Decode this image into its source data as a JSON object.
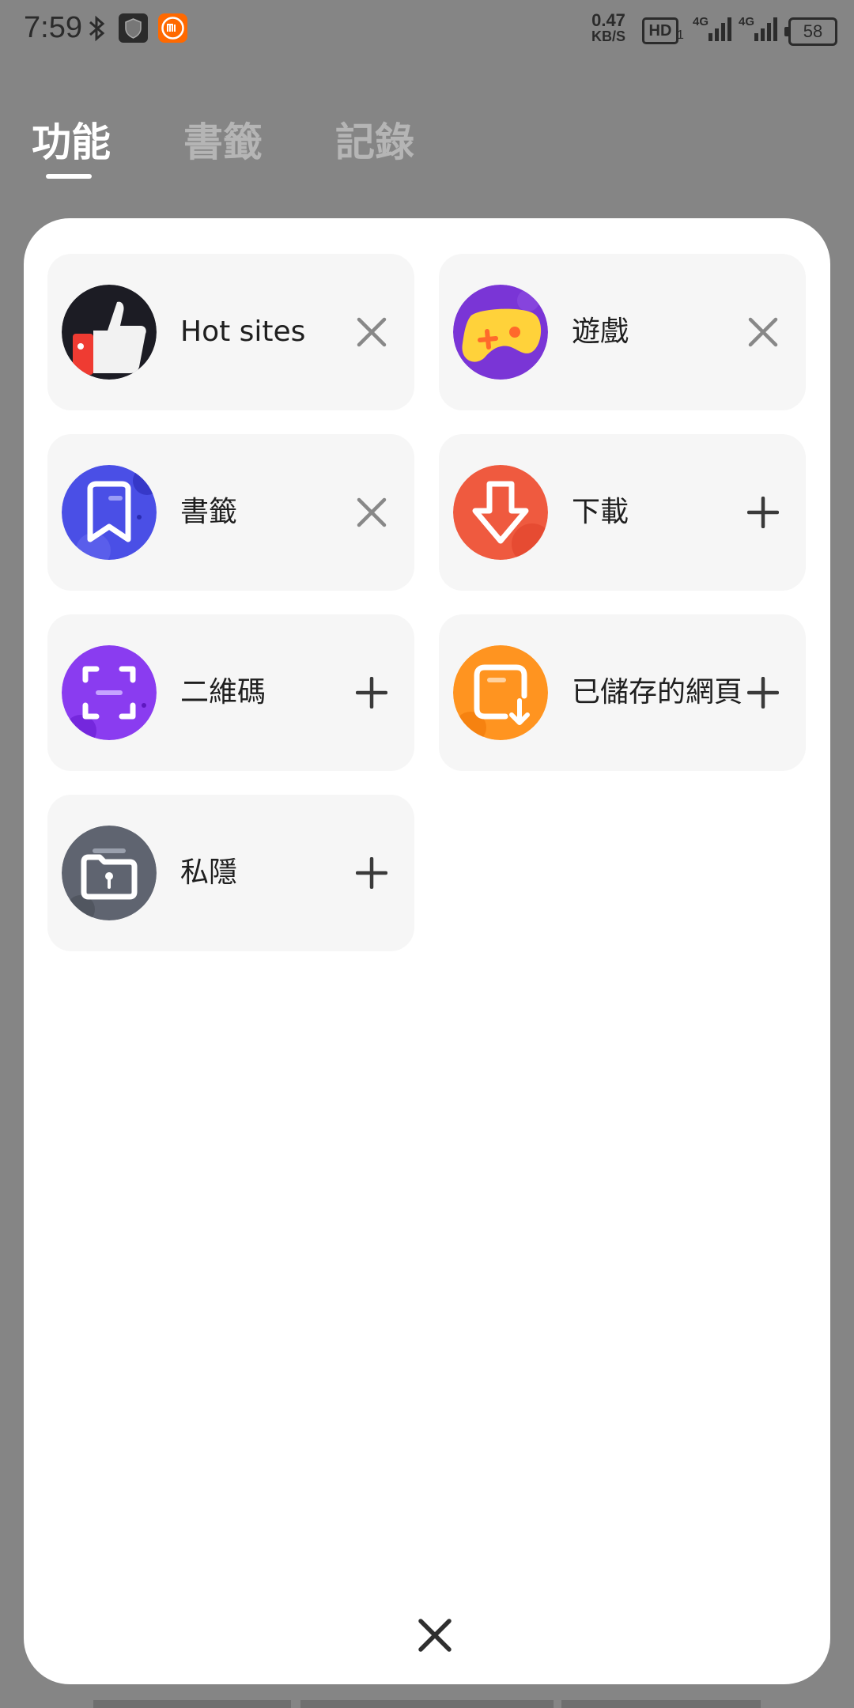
{
  "status_bar": {
    "time": "7:59",
    "net_speed_value": "0.47",
    "net_speed_unit": "KB/S",
    "hd_label": "HD",
    "hd_sub": "1",
    "signal1_label": "4G",
    "signal2_label": "4G",
    "battery": "58"
  },
  "tabs": [
    {
      "label": "功能",
      "active": true
    },
    {
      "label": "書籤",
      "active": false
    },
    {
      "label": "記錄",
      "active": false
    }
  ],
  "cards": [
    {
      "label": "Hot sites",
      "icon": "thumbs-up-icon",
      "action": "remove"
    },
    {
      "label": "遊戲",
      "icon": "gamepad-icon",
      "action": "remove"
    },
    {
      "label": "書籤",
      "icon": "bookmark-icon",
      "action": "remove"
    },
    {
      "label": "下載",
      "icon": "download-icon",
      "action": "add"
    },
    {
      "label": "二維碼",
      "icon": "qr-scan-icon",
      "action": "add"
    },
    {
      "label": "已儲存的網頁",
      "icon": "saved-page-icon",
      "action": "add"
    },
    {
      "label": "私隱",
      "icon": "private-folder-icon",
      "action": "add"
    }
  ],
  "colors": {
    "overlay": "#858585",
    "sheet": "#ffffff",
    "card": "#f6f6f6",
    "bookmark": "#4a4fe6",
    "download": "#ef5a3f",
    "qr": "#8a3cf0",
    "saved": "#ff9420",
    "private": "#5f6470",
    "game": "#7a35d6"
  }
}
